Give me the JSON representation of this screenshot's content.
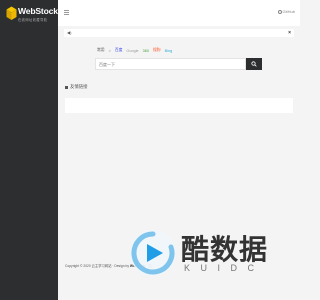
{
  "sidebar": {
    "logo_title": "WebStock",
    "logo_subtitle": "在线网址收藏导航"
  },
  "topbar": {
    "github_label": "GitHub"
  },
  "search": {
    "tabs": [
      {
        "label": "常用",
        "color": "#555555"
      },
      {
        "label": "百度",
        "color": "#3845e6"
      },
      {
        "label": "Google",
        "color": "#999999"
      },
      {
        "label": "360",
        "color": "#49a13c"
      },
      {
        "label": "搜狗",
        "color": "#ff5a2c"
      },
      {
        "label": "Bing",
        "color": "#2ea8d8"
      }
    ],
    "placeholder": "百度一下"
  },
  "section": {
    "title": "友情链接"
  },
  "footer": {
    "prefix": "Copyright © 2020 云主学习网站 · Design by ",
    "brand": "Webstack",
    "suffix": " · 由 ..."
  },
  "watermark": {
    "text": "酷数据",
    "sub": "KUIDC"
  }
}
